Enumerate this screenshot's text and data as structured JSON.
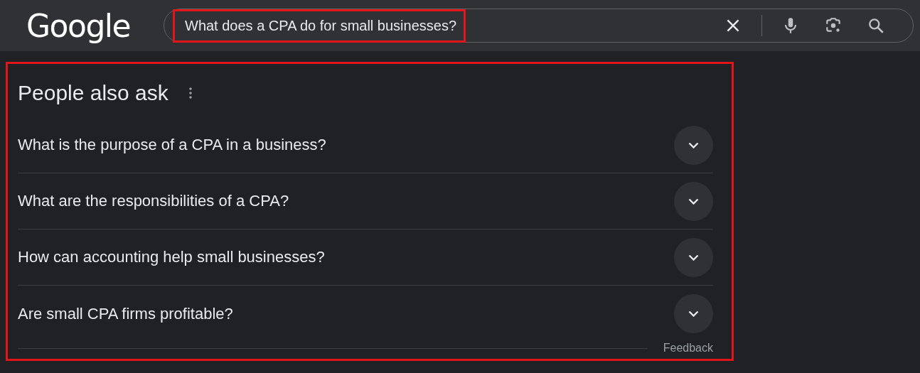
{
  "header": {
    "logo": "Google",
    "search": {
      "value": "What does a CPA do for small businesses?"
    }
  },
  "people_also_ask": {
    "title": "People also ask",
    "questions": [
      {
        "text": "What is the purpose of a CPA in a business?",
        "expanded": false
      },
      {
        "text": "What are the responsibilities of a CPA?",
        "expanded": false
      },
      {
        "text": "How can accounting help small businesses?",
        "expanded": false
      },
      {
        "text": "Are small CPA firms profitable?",
        "expanded": false
      }
    ],
    "feedback": "Feedback"
  }
}
